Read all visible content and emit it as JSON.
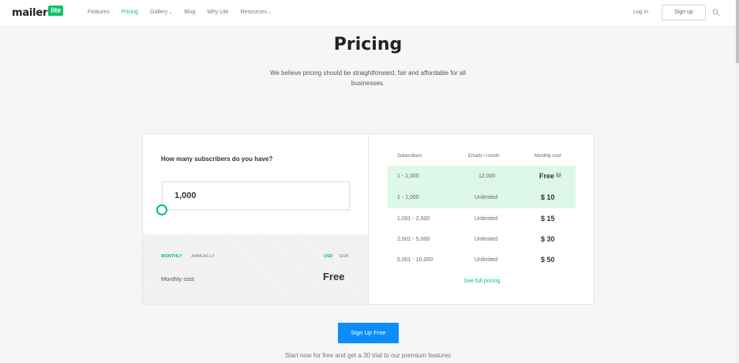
{
  "brand": {
    "name": "mailer",
    "badge": "lite",
    "accent": "#09c269",
    "cta_color": "#0c8dfb"
  },
  "nav": {
    "items": [
      {
        "label": "Features"
      },
      {
        "label": "Pricing"
      },
      {
        "label": "Gallery",
        "caret": "⌄"
      },
      {
        "label": "Blog"
      },
      {
        "label": "Why Lite"
      },
      {
        "label": "Resources",
        "caret": "⌄"
      }
    ],
    "login": "Log in",
    "signup": "Sign up",
    "search_icon": "search-icon"
  },
  "hero": {
    "title": "Pricing",
    "subtitle": "We believe pricing should be straightforward, fair and affordable for all businesses."
  },
  "calculator": {
    "question": "How many subscribers do you have?",
    "subscribers_value": "1,000",
    "slider_fraction": 0.0,
    "billing": {
      "monthly": "MONTHLY",
      "annually": "ANNUALLY",
      "selected": "MONTHLY"
    },
    "currency": {
      "usd": "USD",
      "eur": "EUR",
      "selected": "USD"
    },
    "monthly_cost_label": "Monthly cost",
    "monthly_cost_value": "Free"
  },
  "table": {
    "headers": {
      "subscribers": "Subscribers",
      "emails": "Emails / month",
      "cost": "Monthly cost"
    },
    "rows": [
      {
        "subscribers": "1 - 1,000",
        "emails": "12,000",
        "cost": "Free",
        "highlight": true,
        "info": "?"
      },
      {
        "subscribers": "1 - 1,000",
        "emails": "Unlimited",
        "cost": "$ 10",
        "highlight": true
      },
      {
        "subscribers": "1,001 - 2,500",
        "emails": "Unlimited",
        "cost": "$ 15",
        "highlight": false
      },
      {
        "subscribers": "2,501 - 5,000",
        "emails": "Unlimited",
        "cost": "$ 30",
        "highlight": false
      },
      {
        "subscribers": "5,001 - 10,000",
        "emails": "Unlimited",
        "cost": "$ 50",
        "highlight": false
      }
    ],
    "see_full": "See full pricing"
  },
  "cta": {
    "button": "Sign Up Free",
    "note": "Start now for free and get a 30 trial to our premium features"
  }
}
